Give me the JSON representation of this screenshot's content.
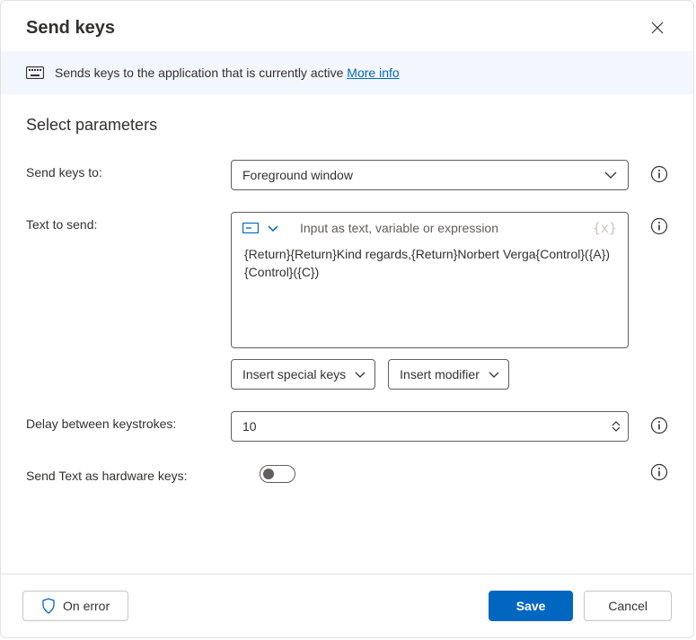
{
  "dialog": {
    "title": "Send keys",
    "description": "Sends keys to the application that is currently active",
    "more_info": "More info"
  },
  "section": {
    "title": "Select parameters"
  },
  "labels": {
    "send_keys_to": "Send keys to:",
    "text_to_send": "Text to send:",
    "delay": "Delay between keystrokes:",
    "hardware": "Send Text as hardware keys:"
  },
  "fields": {
    "send_keys_to_value": "Foreground window",
    "text_hint": "Input as text, variable or expression",
    "text_value": "{Return}{Return}Kind regards,{Return}Norbert Verga{Control}({A}){Control}({C})",
    "delay_value": "10"
  },
  "buttons": {
    "insert_special": "Insert special keys",
    "insert_modifier": "Insert modifier",
    "on_error": "On error",
    "save": "Save",
    "cancel": "Cancel"
  }
}
